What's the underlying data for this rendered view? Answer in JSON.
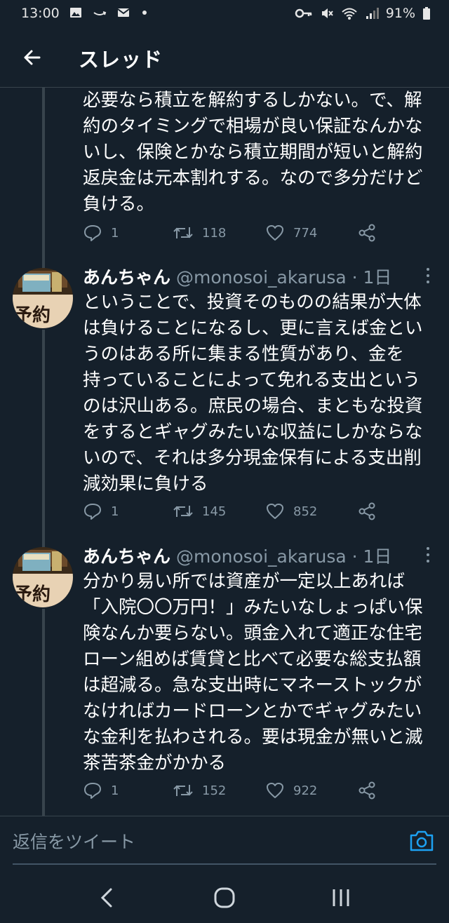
{
  "status_bar": {
    "time": "13:00",
    "battery_percent": "91%",
    "battery_level": 0.91
  },
  "header": {
    "title": "スレッド"
  },
  "tweets": [
    {
      "text": "必要なら積立を解約するしかない。で、解\n約のタイミングで相場が良い保証なんかな\nいし、保険とかなら積立期間が短いと解約\n返戻金は元本割れする。なので多分だけど\n負ける。",
      "replies": "1",
      "retweets": "118",
      "likes": "774"
    },
    {
      "name": "あんちゃん",
      "handle": "@monosoi_akarusa",
      "separator": "·",
      "time": "1日",
      "text": "ということで、投資そのものの結果が大体\nは負けることになるし、更に言えば金とい\nうのはある所に集まる性質があり、金を\n持っていることによって免れる支出という\nのは沢山ある。庶民の場合、まともな投資\nをするとギャグみたいな収益にしかならな\nいので、それは多分現金保有による支出削\n減効果に負ける",
      "replies": "1",
      "retweets": "145",
      "likes": "852"
    },
    {
      "name": "あんちゃん",
      "handle": "@monosoi_akarusa",
      "separator": "·",
      "time": "1日",
      "text": "分かり易い所では資産が一定以上あれば\n「入院〇〇万円！」みたいなしょっぱい保\n険なんか要らない。頭金入れて適正な住宅\nローン組めば賃貸と比べて必要な総支払額\nは超減る。急な支出時にマネーストックが\nなければカードローンとかでギャグみたい\nな金利を払わされる。要は現金が無いと滅\n茶苦茶金がかかる",
      "replies": "1",
      "retweets": "152",
      "likes": "922"
    }
  ],
  "avatar_text": "予約",
  "reply_bar": {
    "placeholder": "返信をツイート"
  },
  "colors": {
    "background": "#15202b",
    "divider": "#38444d",
    "secondary_text": "#8899a6",
    "accent": "#1da1f2"
  },
  "icons": {
    "back": "arrow-left-icon",
    "reply": "speech-bubble-icon",
    "retweet": "retweet-icon",
    "like": "heart-icon",
    "share": "share-icon",
    "more": "vertical-dots-icon",
    "camera": "camera-icon"
  }
}
